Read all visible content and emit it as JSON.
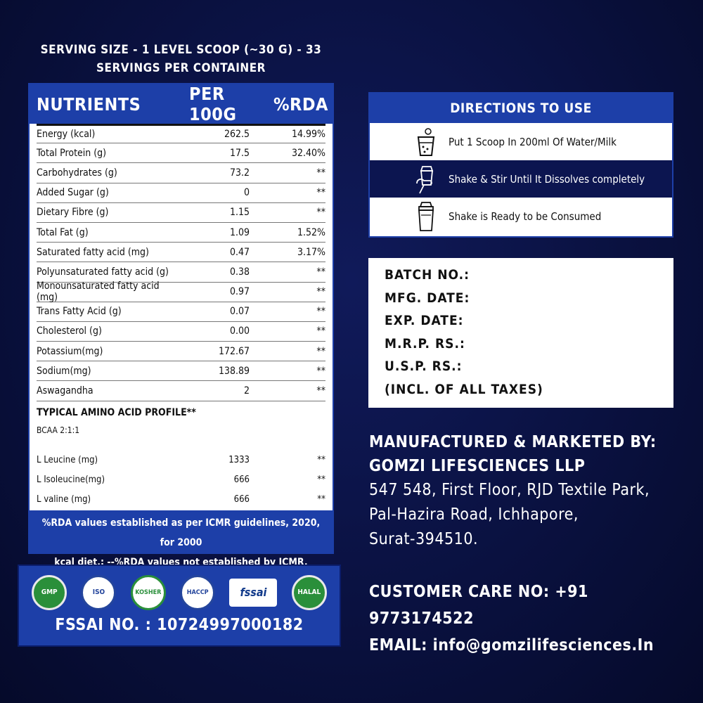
{
  "serving": {
    "line1": "SERVING SIZE - 1 LEVEL SCOOP (~30 G) - 33",
    "line2": "SERVINGS PER CONTAINER"
  },
  "nutrition": {
    "headers": {
      "nutrients": "NUTRIENTS",
      "per100": "PER 100G",
      "rda": "%RDA"
    },
    "rows": [
      {
        "name": "Energy (kcal)",
        "value": "262.5",
        "rda": "14.99%"
      },
      {
        "name": "Total Protein (g)",
        "value": "17.5",
        "rda": "32.40%"
      },
      {
        "name": "Carbohydrates (g)",
        "value": "73.2",
        "rda": "**"
      },
      {
        "name": "Added Sugar (g)",
        "value": "0",
        "rda": "**"
      },
      {
        "name": "Dietary Fibre (g)",
        "value": "1.15",
        "rda": "**"
      },
      {
        "name": "Total Fat (g)",
        "value": "1.09",
        "rda": "1.52%"
      },
      {
        "name": "Saturated fatty acid (mg)",
        "value": "0.47",
        "rda": "3.17%"
      },
      {
        "name": "Polyunsaturated fatty acid (g)",
        "value": "0.38",
        "rda": "**"
      },
      {
        "name": "Monounsaturated fatty acid (mg)",
        "value": "0.97",
        "rda": "**"
      },
      {
        "name": "Trans Fatty Acid (g)",
        "value": "0.07",
        "rda": "**"
      },
      {
        "name": "Cholesterol (g)",
        "value": "0.00",
        "rda": "**"
      },
      {
        "name": "Potassium(mg)",
        "value": "172.67",
        "rda": "**"
      },
      {
        "name": "Sodium(mg)",
        "value": "138.89",
        "rda": "**"
      },
      {
        "name": "Aswagandha",
        "value": "2",
        "rda": "**"
      }
    ],
    "amino_title": "TYPICAL AMINO ACID PROFILE**",
    "bcaa": "BCAA 2:1:1",
    "amino_rows": [
      {
        "name": "L Leucine (mg)",
        "value": "1333",
        "rda": "**"
      },
      {
        "name": "L Isoleucine(mg)",
        "value": "666",
        "rda": "**"
      },
      {
        "name": "L valine (mg)",
        "value": "666",
        "rda": "**"
      }
    ],
    "footnote_line1": "%RDA values established as per ICMR guidelines, 2020, for 2000",
    "footnote_line2": "kcal diet.; --%RDA values not established by ICMR."
  },
  "certifications": {
    "badges": [
      {
        "label": "GMP",
        "icon": "gmp-badge-icon"
      },
      {
        "label": "ISO",
        "icon": "iso-badge-icon"
      },
      {
        "label": "KOSHER",
        "icon": "kosher-badge-icon"
      },
      {
        "label": "HACCP",
        "icon": "haccp-badge-icon"
      },
      {
        "label": "fssai",
        "icon": "fssai-logo-icon"
      },
      {
        "label": "HALAL",
        "icon": "halal-badge-icon"
      }
    ],
    "fssai_no": "FSSAI NO. : 10724997000182"
  },
  "directions": {
    "title": "DIRECTIONS TO USE",
    "steps": [
      {
        "text": "Put 1 Scoop In 200ml Of Water/Milk",
        "icon": "glass-scoop-icon"
      },
      {
        "text": "Shake & Stir Until It Dissolves completely",
        "icon": "hand-shaker-icon"
      },
      {
        "text": "Shake is Ready to be Consumed",
        "icon": "shaker-bottle-icon"
      }
    ]
  },
  "batch": {
    "batch_no": "BATCH  NO.:",
    "mfg_date": "MFG.  DATE:",
    "exp_date": "EXP.   DATE:",
    "mrp": "M.R.P.  RS.:",
    "usp": "U.S.P.    RS.:",
    "taxes": "(INCL. OF ALL TAXES)"
  },
  "manufacturer": {
    "label": "MANUFACTURED & MARKETED BY:",
    "company": "GOMZI LIFESCIENCES LLP",
    "address1": "547 548, First Floor, RJD Textile Park,",
    "address2": "Pal-Hazira Road, Ichhapore,",
    "address3": "Surat-394510."
  },
  "contact": {
    "customer_care": "CUSTOMER CARE NO: +91 9773174522",
    "email": "EMAIL: info@gomzilifesciences.In"
  },
  "colors": {
    "background": "#0a1140",
    "panel_blue": "#1d3fa8",
    "dark_row": "#0c1550"
  }
}
